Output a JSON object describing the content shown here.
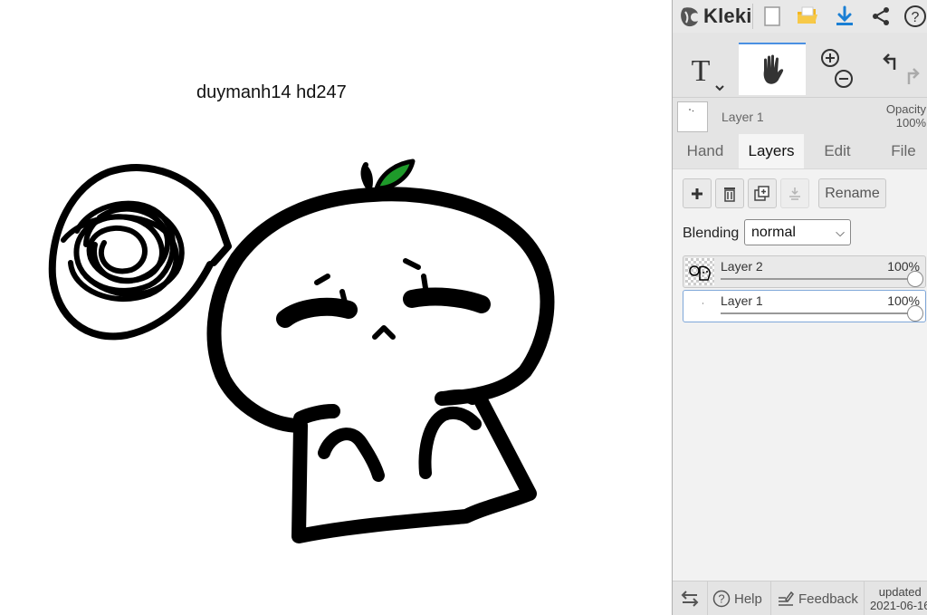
{
  "canvas": {
    "text": "duymanh14 hd247"
  },
  "app": {
    "logo_text": "Kleki",
    "top_icons": [
      "new-file-icon",
      "open-folder-icon",
      "download-icon",
      "share-icon",
      "help-icon"
    ],
    "accent_color": "#1a7fd4"
  },
  "tools": {
    "items": [
      "text-tool-icon",
      "hand-tool-icon",
      "zoom-tool-icon",
      "undo-redo-icon"
    ],
    "active": "hand-tool-icon"
  },
  "current_layer": {
    "name": "Layer 1",
    "opacity_label": "Opacity",
    "opacity_value": "100%"
  },
  "tabs": [
    {
      "label": "Hand",
      "active": false
    },
    {
      "label": "Layers",
      "active": true
    },
    {
      "label": "Edit",
      "active": false
    },
    {
      "label": "File",
      "active": false
    }
  ],
  "layers_panel": {
    "buttons": [
      "add-layer-icon",
      "delete-layer-icon",
      "duplicate-layer-icon",
      "merge-down-icon"
    ],
    "rename_label": "Rename",
    "blending_label": "Blending",
    "blending_value": "normal",
    "layers": [
      {
        "name": "Layer 2",
        "opacity": "100%",
        "opacity_fraction": 1.0,
        "selected": false
      },
      {
        "name": "Layer 1",
        "opacity": "100%",
        "opacity_fraction": 1.0,
        "selected": true
      }
    ]
  },
  "bottom_bar": {
    "help_label": "Help",
    "feedback_label": "Feedback",
    "updated_label": "updated",
    "updated_date": "2021-06-16"
  }
}
